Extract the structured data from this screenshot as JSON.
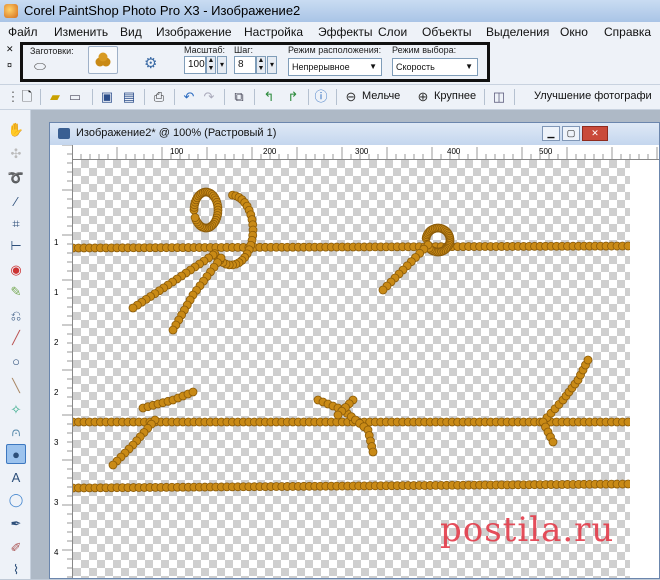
{
  "window": {
    "title": "Corel PaintShop Photo Pro X3 - Изображение2"
  },
  "menu": [
    "Файл",
    "Изменить",
    "Вид",
    "Изображение",
    "Настройка",
    "Эффекты",
    "Слои",
    "Объекты",
    "Выделения",
    "Окно",
    "Справка"
  ],
  "options": {
    "presets_label": "Заготовки:",
    "scale_label": "Масштаб:",
    "scale_value": "100",
    "step_label": "Шаг:",
    "step_value": "8",
    "placement_label": "Режим расположения:",
    "placement_value": "Непрерывное",
    "selection_label": "Режим выбора:",
    "selection_value": "Скорость"
  },
  "toolbar": {
    "zoom_out_label": "Мельче",
    "zoom_in_label": "Крупнее",
    "enhance_label": "Улучшение фотографи"
  },
  "document": {
    "title": "Изображение2* @ 100% (Растровый 1)",
    "ruler_h": [
      "100",
      "200",
      "300",
      "400",
      "500"
    ],
    "ruler_v": [
      "1",
      "1",
      "2",
      "2",
      "3",
      "3",
      "4"
    ]
  },
  "watermark": "postila.ru",
  "colors": {
    "rope": "#c98a16",
    "rope_shadow": "#8a5a08",
    "highlight_border": "#111111"
  }
}
